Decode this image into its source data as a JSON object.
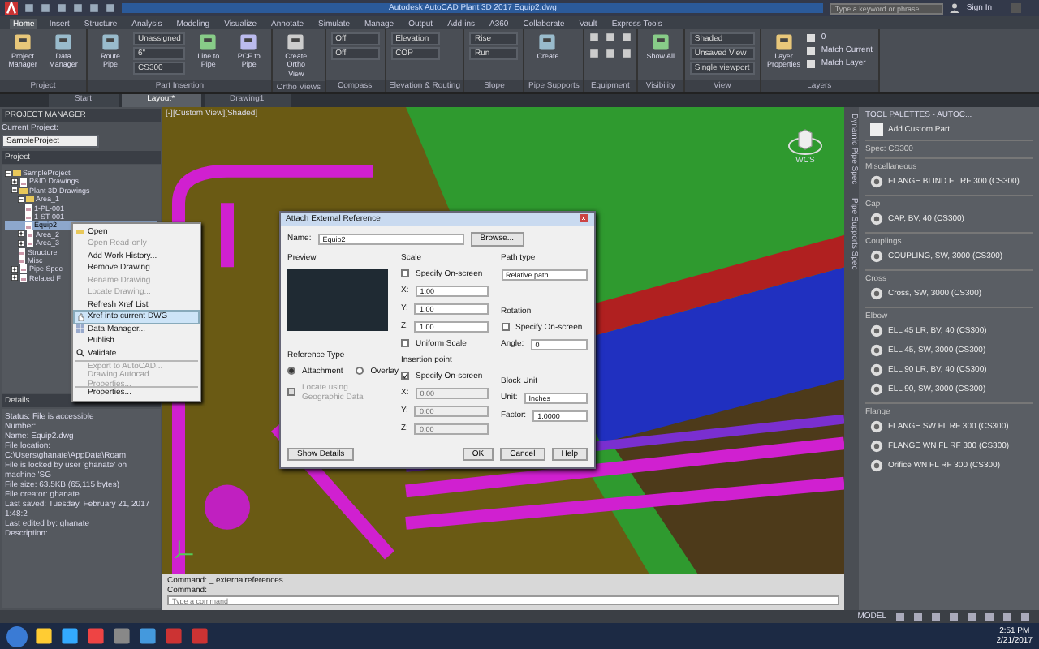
{
  "window": {
    "title": "Autodesk AutoCAD Plant 3D 2017  Equip2.dwg",
    "search_placeholder": "Type a keyword or phrase",
    "sign_in": "Sign In"
  },
  "ribbon_tabs": [
    {
      "label": "Home",
      "selected": true
    },
    {
      "label": "Insert",
      "selected": false
    },
    {
      "label": "Structure",
      "selected": false
    },
    {
      "label": "Analysis",
      "selected": false
    },
    {
      "label": "Modeling",
      "selected": false
    },
    {
      "label": "Visualize",
      "selected": false
    },
    {
      "label": "Annotate",
      "selected": false
    },
    {
      "label": "Simulate",
      "selected": false
    },
    {
      "label": "Manage",
      "selected": false
    },
    {
      "label": "Output",
      "selected": false
    },
    {
      "label": "Add-ins",
      "selected": false
    },
    {
      "label": "A360",
      "selected": false
    },
    {
      "label": "Collaborate",
      "selected": false
    },
    {
      "label": "Vault",
      "selected": false
    },
    {
      "label": "Express Tools",
      "selected": false
    }
  ],
  "ribbon_panels": [
    {
      "label": "Project",
      "tools": [
        {
          "kind": "big",
          "label": "Project Manager"
        },
        {
          "kind": "big",
          "label": "Data Manager"
        }
      ]
    },
    {
      "label": "Part Insertion",
      "tools": [
        {
          "kind": "big",
          "label": "Route Pipe"
        },
        {
          "kind": "combos",
          "items": [
            "Unassigned",
            "6\"",
            "CS300"
          ]
        },
        {
          "kind": "big",
          "label": "Line to Pipe"
        },
        {
          "kind": "big",
          "label": "PCF to Pipe"
        }
      ]
    },
    {
      "label": "Ortho Views",
      "tools": [
        {
          "kind": "big",
          "label": "Create Ortho View"
        }
      ]
    },
    {
      "label": "Compass",
      "tools": [
        {
          "kind": "combos",
          "items": [
            "Off",
            "Off"
          ]
        }
      ]
    },
    {
      "label": "Elevation & Routing",
      "tools": [
        {
          "kind": "combos",
          "items": [
            "Elevation",
            "COP"
          ]
        }
      ]
    },
    {
      "label": "Slope",
      "tools": [
        {
          "kind": "combos",
          "items": [
            "Rise",
            "Run"
          ]
        }
      ]
    },
    {
      "label": "Pipe Supports",
      "tools": [
        {
          "kind": "big",
          "label": "Create"
        }
      ]
    },
    {
      "label": "Equipment",
      "tools": [
        {
          "kind": "icons"
        }
      ]
    },
    {
      "label": "Visibility",
      "tools": [
        {
          "kind": "big",
          "label": "Show All"
        }
      ]
    },
    {
      "label": "View",
      "tools": [
        {
          "kind": "combos",
          "items": [
            "Shaded",
            "Unsaved View",
            "Single viewport"
          ]
        }
      ]
    },
    {
      "label": "Layers",
      "tools": [
        {
          "kind": "big",
          "label": "Layer Properties"
        },
        {
          "kind": "links",
          "items": [
            "0",
            "Match Current",
            "Match Layer"
          ]
        }
      ]
    }
  ],
  "file_tabs": [
    {
      "label": "Start",
      "selected": false
    },
    {
      "label": "Layout*",
      "selected": true
    },
    {
      "label": "Drawing1",
      "selected": false
    }
  ],
  "project_manager": {
    "title": "PROJECT MANAGER",
    "current_label": "Current Project:",
    "current_value": "SampleProject",
    "tree_header": "Project",
    "tree": [
      {
        "label": "SampleProject",
        "expanded": true,
        "selected": false,
        "children": [
          {
            "label": "P&ID Drawings",
            "expanded": false,
            "selected": false
          },
          {
            "label": "Plant 3D Drawings",
            "expanded": true,
            "selected": false,
            "children": [
              {
                "label": "Area_1",
                "expanded": true,
                "selected": false,
                "children": [
                  {
                    "label": "1-PL-001",
                    "selected": false
                  },
                  {
                    "label": "1-ST-001",
                    "selected": false
                  },
                  {
                    "label": "Equip2",
                    "selected": true
                  }
                ]
              },
              {
                "label": "Area_2",
                "expanded": false,
                "selected": false
              },
              {
                "label": "Area_3",
                "expanded": false,
                "selected": false
              },
              {
                "label": "Structure",
                "selected": false
              },
              {
                "label": "Misc",
                "selected": false
              }
            ]
          },
          {
            "label": "Pipe Spec",
            "expanded": false,
            "selected": false
          },
          {
            "label": "Related F",
            "expanded": false,
            "selected": false
          }
        ]
      }
    ],
    "details_header": "Details",
    "details": [
      "Status: File is accessible",
      "Number:",
      "Name: Equip2.dwg",
      "File location: C:\\Users\\ghanate\\AppData\\Roam",
      "File is locked by user 'ghanate' on machine 'SG",
      "File size: 63.5KB (65,115 bytes)",
      "File creator: ghanate",
      "Last saved: Tuesday, February 21, 2017 1:48:2",
      "Last edited by: ghanate",
      "Description:"
    ]
  },
  "context_menu": [
    {
      "label": "Open",
      "disabled": false,
      "selected": false
    },
    {
      "label": "Open Read-only",
      "disabled": true,
      "selected": false
    },
    {
      "label": "Add Work History...",
      "disabled": false,
      "selected": false
    },
    {
      "label": "Remove Drawing",
      "disabled": false,
      "selected": false
    },
    {
      "label": "Rename Drawing...",
      "disabled": true,
      "selected": false
    },
    {
      "label": "Locate Drawing...",
      "disabled": true,
      "selected": false
    },
    {
      "label": "Refresh Xref List",
      "disabled": false,
      "selected": false
    },
    {
      "label": "Xref into current DWG",
      "disabled": false,
      "selected": true
    },
    {
      "label": "Data Manager...",
      "disabled": false,
      "selected": false
    },
    {
      "label": "Publish...",
      "disabled": false,
      "selected": false
    },
    {
      "label": "Validate...",
      "disabled": false,
      "selected": false
    },
    {
      "label": "Export to AutoCAD...",
      "disabled": true,
      "selected": false
    },
    {
      "label": "Drawing Autocad Properties...",
      "disabled": true,
      "selected": false
    },
    {
      "label": "Properties...",
      "disabled": false,
      "selected": false
    }
  ],
  "viewport": {
    "label": "[-][Custom View][Shaded]",
    "viewcube_label": "WCS"
  },
  "dialog": {
    "title": "Attach External Reference",
    "name_label": "Name:",
    "name_value": "Equip2",
    "browse": "Browse...",
    "preview_label": "Preview",
    "scale": {
      "label": "Scale",
      "on_screen": {
        "label": "Specify On-screen",
        "checked": false
      },
      "fields": [
        {
          "axis": "X:",
          "value": "1.00",
          "disabled": false
        },
        {
          "axis": "Y:",
          "value": "1.00",
          "disabled": false
        },
        {
          "axis": "Z:",
          "value": "1.00",
          "disabled": false
        }
      ],
      "uniform": {
        "label": "Uniform Scale",
        "checked": false
      }
    },
    "insertion": {
      "label": "Insertion point",
      "on_screen": {
        "label": "Specify On-screen",
        "checked": true
      },
      "fields": [
        {
          "axis": "X:",
          "value": "0.00",
          "disabled": true
        },
        {
          "axis": "Y:",
          "value": "0.00",
          "disabled": true
        },
        {
          "axis": "Z:",
          "value": "0.00",
          "disabled": true
        }
      ]
    },
    "path_type": {
      "label": "Path type",
      "value": "Relative path"
    },
    "rotation": {
      "label": "Rotation",
      "on_screen": {
        "label": "Specify On-screen",
        "checked": false
      },
      "angle_label": "Angle:",
      "angle_value": "0"
    },
    "block_unit": {
      "label": "Block Unit",
      "unit_label": "Unit:",
      "unit_value": "Inches",
      "factor_label": "Factor:",
      "factor_value": "1.0000"
    },
    "reference_type": {
      "label": "Reference Type",
      "options": [
        {
          "label": "Attachment",
          "selected": true
        },
        {
          "label": "Overlay",
          "selected": false
        }
      ]
    },
    "geo": {
      "label": "Locate using Geographic Data",
      "checked": false,
      "disabled": true
    },
    "details_button": "Show Details",
    "buttons": [
      "OK",
      "Cancel",
      "Help"
    ]
  },
  "tool_palette": {
    "title": "TOOL PALETTES - AUTOC...",
    "side_tabs": [
      "Dynamic Pipe Spec",
      "Pipe Supports Spec"
    ],
    "add_custom_part": "Add Custom Part",
    "sections": [
      {
        "title": "Spec: CS300"
      },
      {
        "title": "Miscellaneous",
        "items": [
          "FLANGE BLIND FL RF 300 (CS300)"
        ]
      },
      {
        "title": "Cap",
        "items": [
          "CAP, BV, 40 (CS300)"
        ]
      },
      {
        "title": "Couplings",
        "items": [
          "COUPLING, SW, 3000 (CS300)"
        ]
      },
      {
        "title": "Cross",
        "items": [
          "Cross, SW, 3000 (CS300)"
        ]
      },
      {
        "title": "Elbow",
        "items": [
          "ELL 45 LR, BV, 40 (CS300)",
          "ELL 45, SW, 3000 (CS300)",
          "ELL 90 LR, BV, 40 (CS300)",
          "ELL 90, SW, 3000 (CS300)"
        ]
      },
      {
        "title": "Flange",
        "items": [
          "FLANGE SW FL RF 300 (CS300)",
          "FLANGE WN FL RF 300 (CS300)",
          "Orifice WN FL RF 300 (CS300)"
        ]
      }
    ]
  },
  "command_line": {
    "history": [
      "Command: _.externalreferences",
      "Command:"
    ],
    "placeholder": "Type a command"
  },
  "status_bar": {
    "model": "MODEL"
  },
  "taskbar": {
    "time": "2:51 PM",
    "date": "2/21/2017"
  }
}
